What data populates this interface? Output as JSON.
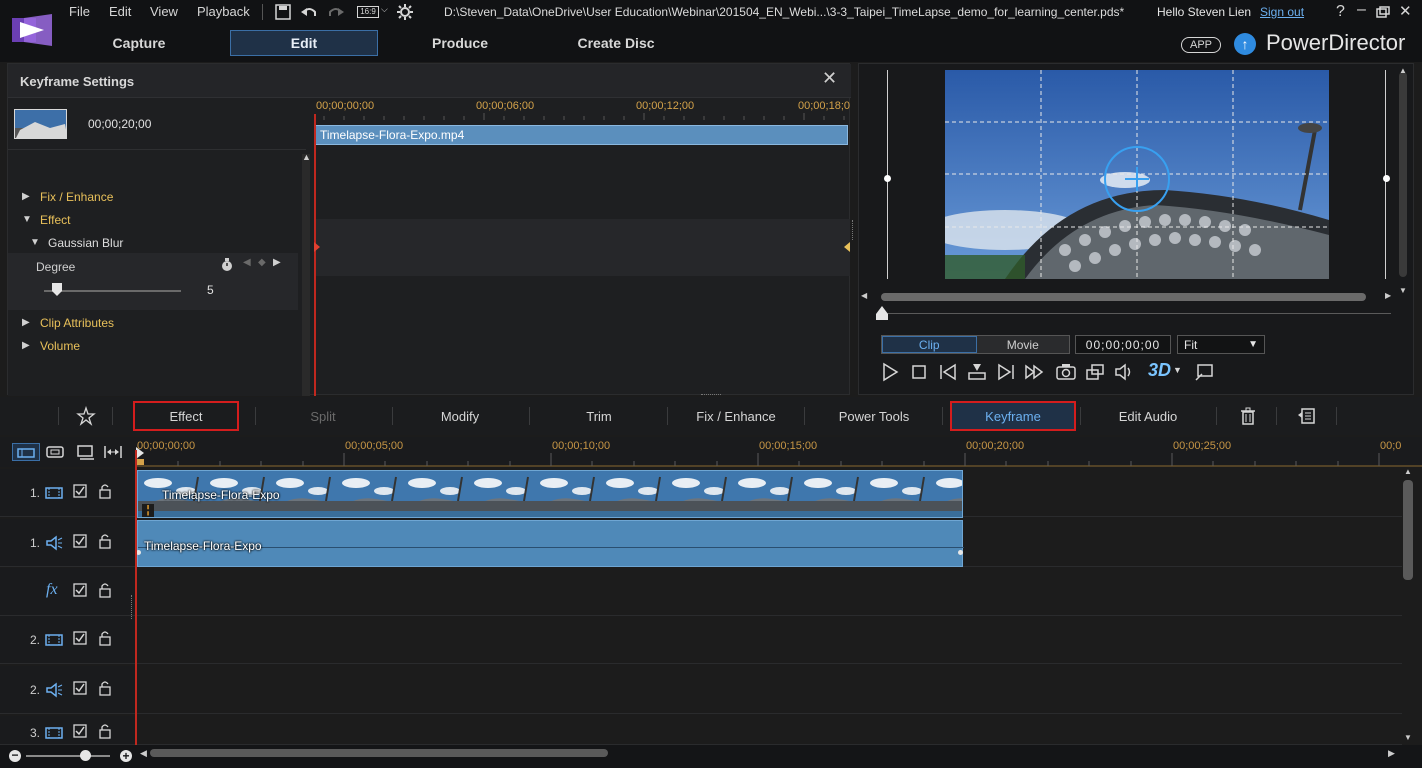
{
  "menu": [
    "File",
    "Edit",
    "View",
    "Playback"
  ],
  "aspect_ratio": "16:9",
  "file_path": "D:\\Steven_Data\\OneDrive\\User Education\\Webinar\\201504_EN_Webi...\\3-3_Taipei_TimeLapse_demo_for_learning_center.pds*",
  "user": {
    "greeting": "Hello Steven Lien",
    "sign_out": "Sign out"
  },
  "modes": [
    "Capture",
    "Edit",
    "Produce",
    "Create Disc"
  ],
  "brand": {
    "app_badge": "APP",
    "name": "PowerDirector"
  },
  "keyframe": {
    "title": "Keyframe Settings",
    "clip_time": "00;00;20;00",
    "rows": [
      {
        "label": "Fix / Enhance"
      },
      {
        "label": "Effect"
      },
      {
        "label": "Gaussian Blur"
      },
      {
        "label": "Clip Attributes"
      },
      {
        "label": "Volume"
      }
    ],
    "degree": {
      "label": "Degree",
      "value": "5"
    },
    "ruler": [
      "00;00;00;00",
      "00;00;06;00",
      "00;00;12;00",
      "00;00;18;0"
    ],
    "clip_name": "Timelapse-Flora-Expo.mp4"
  },
  "preview": {
    "tabs": [
      "Clip",
      "Movie"
    ],
    "timecode": "00;00;00;00",
    "fit": "Fit",
    "mode3d": "3D"
  },
  "toolbar": {
    "effect": "Effect",
    "split": "Split",
    "modify": "Modify",
    "trim": "Trim",
    "fix_enhance": "Fix / Enhance",
    "power_tools": "Power Tools",
    "keyframe": "Keyframe",
    "edit_audio": "Edit Audio"
  },
  "timeline": {
    "ruler": [
      "00;00;00;00",
      "00;00;05;00",
      "00;00;10;00",
      "00;00;15;00",
      "00;00;20;00",
      "00;00;25;00",
      "00;0"
    ],
    "tracks": [
      {
        "num": "1.",
        "icon": "video-track-icon"
      },
      {
        "num": "1.",
        "icon": "audio-track-icon"
      },
      {
        "num": "",
        "icon": "fx-icon",
        "fx": "fx"
      },
      {
        "num": "2.",
        "icon": "video-track-icon"
      },
      {
        "num": "2.",
        "icon": "audio-track-icon"
      },
      {
        "num": "3.",
        "icon": "video-track-icon"
      }
    ],
    "video_clip": "Timelapse-Flora-Expo",
    "audio_clip": "Timelapse-Flora-Expo"
  },
  "colors": {
    "accent": "#2f8be0",
    "highlight": "#d41d1d",
    "playhead": "#c0281f",
    "keyframe_label": "#e8c05a"
  }
}
